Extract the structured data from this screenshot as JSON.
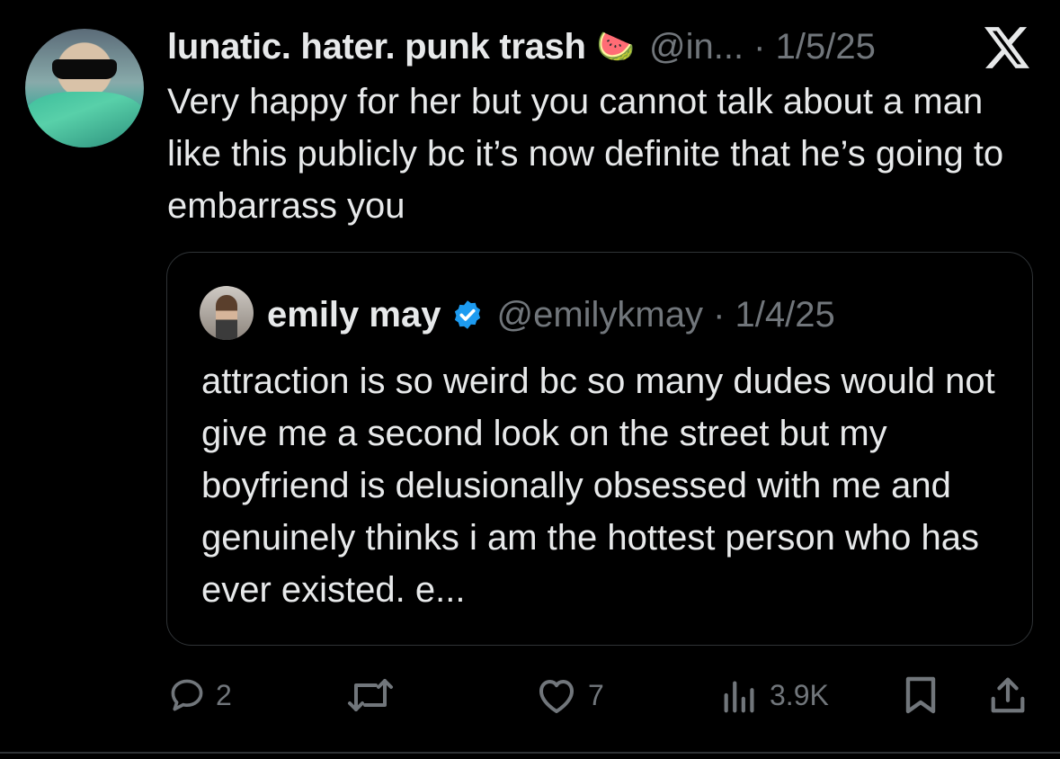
{
  "tweet": {
    "author_name": "lunatic. hater. punk trash",
    "author_emoji": "🍉",
    "handle_date": "@in... · 1/5/25",
    "text": "Very happy for her but you cannot talk about a man like this publicly bc it’s now definite that he’s going to embarrass you"
  },
  "platform_icon": "x-logo-icon",
  "quoted": {
    "author_name": "emily may",
    "verified_icon": "verified-badge-icon",
    "handle_date": "@emilykmay · 1/4/25",
    "text": "attraction is so weird bc so many dudes would not give me a second look on the street but my boyfriend is delusionally obsessed with me and genuinely thinks i am the hottest person who has ever existed. e..."
  },
  "actions": {
    "reply_count": "2",
    "like_count": "7",
    "views_count": "3.9K"
  },
  "colors": {
    "background": "#000000",
    "text": "#e7e9ea",
    "secondary": "#71767b",
    "verified": "#1d9bf0",
    "border": "#2f3336"
  }
}
